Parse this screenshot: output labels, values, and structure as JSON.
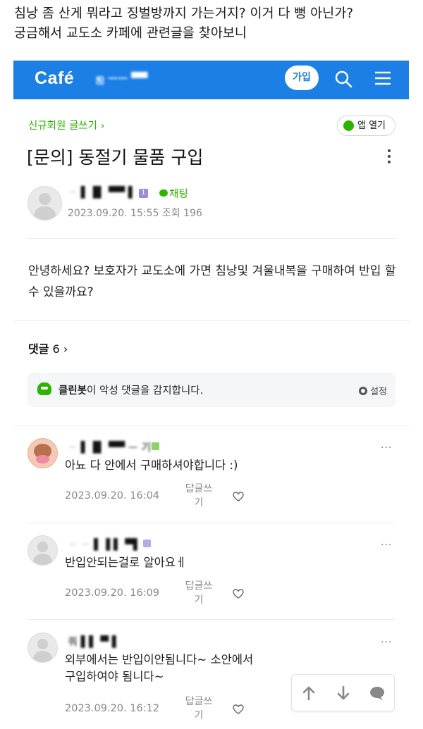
{
  "caption": {
    "line1": "침낭 좀 산게 뭐라고 징벌방까지 가는거지? 이거 다 뻥 아닌가?",
    "line2": "궁금해서 교도소 카페에 관련글을 찾아보니"
  },
  "header": {
    "logo": "Café",
    "cafe_name": "ஐ ᅳᅳ ▀▀",
    "join_label": "가입",
    "brand_color": "#1b7fe6"
  },
  "post": {
    "board_link": "신규회원 글쓰기 ›",
    "app_open_label": "앱 열기",
    "title": "[문의] 동절기 물품 구입",
    "author": "ᆢ ▌▐▌ ▀▀ ▌",
    "grade": "1",
    "chat_label": "채팅",
    "meta": "2023.09.20. 15:55  조회 196",
    "body": "안녕하세요? 보호자가 교도소에 가면 침낭및 겨울내복을 구매하여 반입 할 수 있을까요?"
  },
  "comments_section": {
    "label": "댓글",
    "count": "6",
    "chevron": "›"
  },
  "cleanbot": {
    "name": "클린봇",
    "message": "이 악성 댓글을 감지합니다.",
    "settings_label": "설정"
  },
  "comments": [
    {
      "author": "ᆢ ▌▐▌ ▀▀ ᅳ 기",
      "text": "아뇨 다 안에서 구매하셔야합니다 :)",
      "date": "2023.09.20. 16:04",
      "reply_label": "답글쓰기"
    },
    {
      "author": "ᆢ ᆢ ▌▐ ▌ ▀▌",
      "text": "반입안되는걸로 알아요ㅔ",
      "date": "2023.09.20. 16:09",
      "reply_label": "답글쓰기"
    },
    {
      "author": "쿼 ▌▌ ▀ ▌",
      "text": "외부에서는 반입이안됨니다~ 소안에서 구입하여야 됨니다~",
      "date": "2023.09.20. 16:12",
      "reply_label": "답글쓰기"
    }
  ],
  "comment_more": "···",
  "icons": {
    "search": "search-icon",
    "menu": "hamburger-menu-icon",
    "more": "more-vertical-icon",
    "heart": "heart-icon",
    "up": "arrow-up-icon",
    "down": "arrow-down-icon",
    "comment": "comment-icon"
  },
  "colors": {
    "accent_green": "#2db400",
    "meta_gray": "#888888"
  }
}
